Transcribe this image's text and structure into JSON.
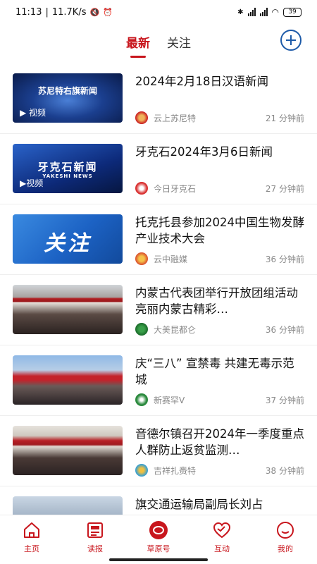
{
  "status_bar": {
    "time": "11:13",
    "net_speed": "11.7K/s",
    "battery": "39"
  },
  "top_tabs": [
    {
      "label": "最新",
      "active": true
    },
    {
      "label": "关注",
      "active": false
    }
  ],
  "news": [
    {
      "title": "2024年2月18日汉语新闻",
      "source": "云上苏尼特",
      "time": "21 分钟前",
      "thumb_text": "苏尼特右旗新闻",
      "video": "▶ 视频"
    },
    {
      "title": "牙克石2024年3月6日新闻",
      "source": "今日牙克石",
      "time": "27 分钟前",
      "thumb_text": "牙克石新闻",
      "thumb_sub": "YAKESHI NEWS",
      "video": "▶视频"
    },
    {
      "title": "托克托县参加2024中国生物发酵产业技术大会",
      "source": "云中融媒",
      "time": "36 分钟前",
      "thumb_text": "关注"
    },
    {
      "title": "内蒙古代表团举行开放团组活动 亮丽内蒙古精彩…",
      "source": "大美昆都仑",
      "time": "36 分钟前"
    },
    {
      "title": "庆“三八” 宣禁毒 共建无毒示范城",
      "source": "新赛罕V",
      "time": "37 分钟前"
    },
    {
      "title": "音德尔镇召开2024年一季度重点人群防止返贫监测…",
      "source": "吉祥扎赉特",
      "time": "38 分钟前"
    },
    {
      "title": "旗交通运输局副局长刘占",
      "source": "",
      "time": ""
    }
  ],
  "bottom_nav": [
    {
      "label": "主页",
      "icon": "home-icon"
    },
    {
      "label": "读报",
      "icon": "newspaper-icon"
    },
    {
      "label": "草原号",
      "icon": "grassland-icon"
    },
    {
      "label": "互动",
      "icon": "heart-icon"
    },
    {
      "label": "我的",
      "icon": "profile-icon"
    }
  ],
  "colors": {
    "accent": "#c8161d",
    "add_button": "#1d5aa8"
  }
}
